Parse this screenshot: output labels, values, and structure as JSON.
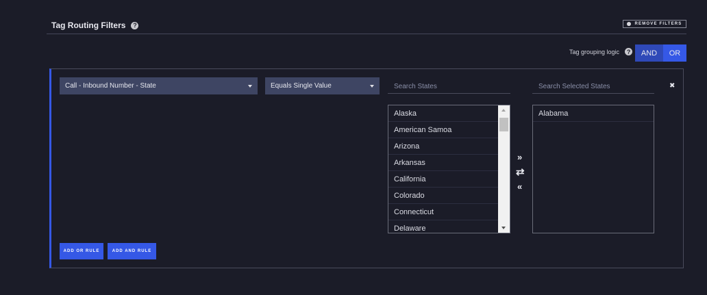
{
  "header": {
    "title": "Tag Routing Filters",
    "help_icon": "question-circle-icon",
    "remove_filters_label": "REMOVE FILTERS"
  },
  "grouping": {
    "label": "Tag grouping logic",
    "options": [
      "AND",
      "OR"
    ],
    "selected": "OR"
  },
  "rule": {
    "field_select": "Call - Inbound Number - State",
    "operator_select": "Equals Single Value",
    "available": {
      "placeholder": "Search States",
      "items": [
        "Alaska",
        "American Samoa",
        "Arizona",
        "Arkansas",
        "California",
        "Colorado",
        "Connecticut",
        "Delaware"
      ]
    },
    "selected": {
      "placeholder": "Search Selected States",
      "items": [
        "Alabama"
      ]
    },
    "move_right": "»",
    "swap": "⇄",
    "move_left": "«",
    "remove": "✖"
  },
  "buttons": {
    "add_or": "ADD OR RULE",
    "add_and": "ADD AND RULE"
  },
  "colors": {
    "accent": "#3558e6",
    "background": "#1b1c28",
    "select": "#3e4563"
  }
}
